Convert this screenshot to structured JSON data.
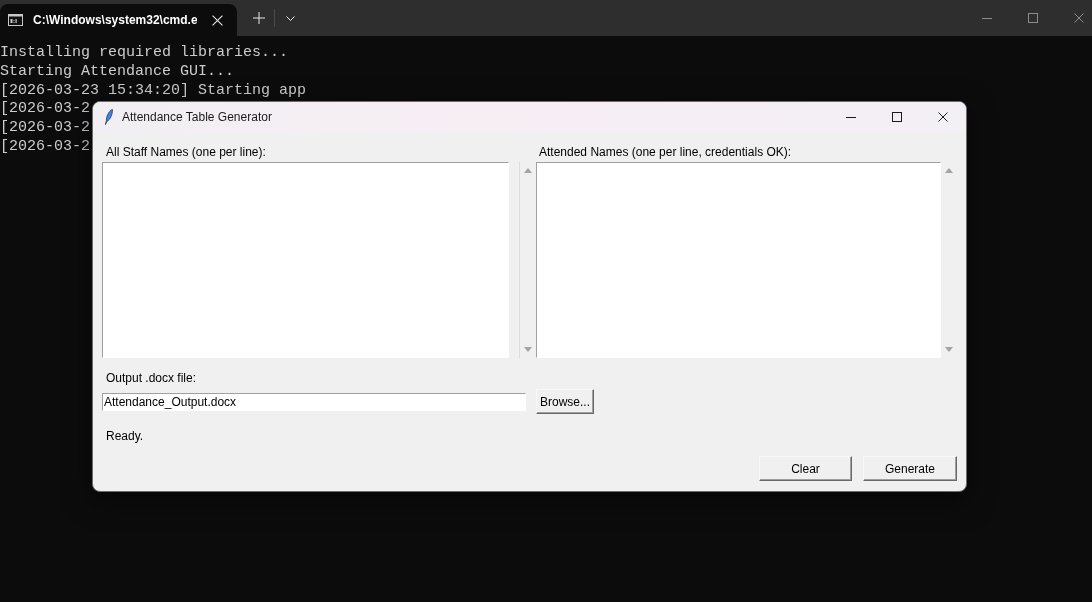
{
  "terminal": {
    "tabs": [
      {
        "title": "C:\\Windows\\system32\\cmd.e",
        "selected": true
      }
    ],
    "lines": [
      "Installing required libraries...",
      "Starting Attendance GUI...",
      "[2026-03-23 15:34:20] Starting app",
      "[2026-03-2",
      "[2026-03-2",
      "[2026-03-2"
    ]
  },
  "dialog": {
    "title": "Attendance Table Generator",
    "name_lists": [
      {
        "label": "All Staff Names (one per line):"
      },
      {
        "label": "Attended Names (one per line, credentials OK):"
      }
    ],
    "output_file": {
      "label": "Output .docx file:",
      "value": "Attendance_Output.docx",
      "button": "Browse..."
    },
    "status": "Ready.",
    "buttons": [
      "Clear",
      "Generate"
    ]
  }
}
